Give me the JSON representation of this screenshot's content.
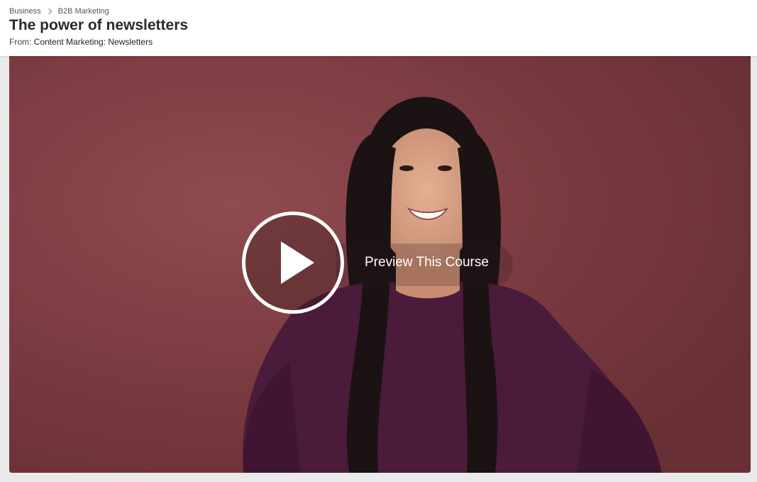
{
  "breadcrumb": {
    "items": [
      {
        "label": "Business"
      },
      {
        "label": "B2B Marketing"
      }
    ]
  },
  "page": {
    "title": "The power of newsletters",
    "from_prefix": "From: ",
    "from_course": "Content Marketing: Newsletters"
  },
  "video": {
    "preview_label": "Preview This Course",
    "icons": {
      "play": "play-icon"
    },
    "colors": {
      "backdrop": "#7a3b40",
      "sweater": "#4a1b3a",
      "hair": "#1a1213",
      "skin": "#d9a487"
    }
  }
}
